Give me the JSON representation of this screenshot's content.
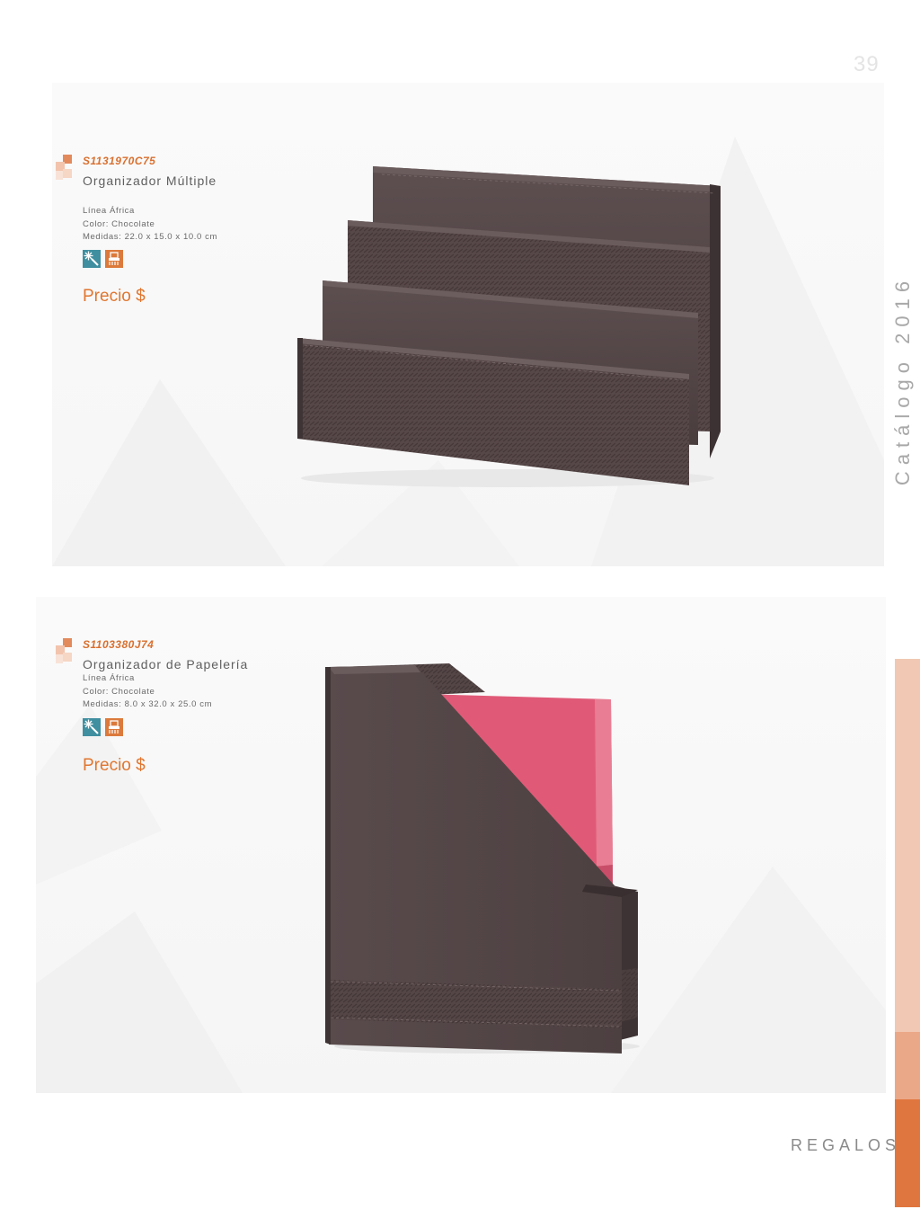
{
  "page": {
    "number": "39",
    "side_title": "Catálogo 2016",
    "section": "REGALOS"
  },
  "colors": {
    "accent": "#e0762f",
    "bar_light": "#f1c8b3",
    "bar_mid": "#eba888",
    "bar_dark": "#e0763f",
    "product_brown": "#57494a",
    "folder_pink": "#e05a77",
    "icon_teal": "#3f8fa0",
    "icon_orange": "#dc7a3c"
  },
  "products": [
    {
      "sku": "S1131970C75",
      "name": "Organizador Múltiple",
      "line": "Línea África",
      "color": "Color: Chocolate",
      "measures": "Medidas: 22.0 x 15.0 x 10.0 cm",
      "icons": [
        "laser-engraving-icon",
        "hot-stamping-icon"
      ],
      "price": "Precio $"
    },
    {
      "sku": "S1103380J74",
      "name": "Organizador de Papelería",
      "line": "Línea África",
      "color": "Color: Chocolate",
      "measures": "Medidas: 8.0 x 32.0 x 25.0 cm",
      "icons": [
        "laser-engraving-icon",
        "hot-stamping-icon"
      ],
      "price": "Precio $"
    }
  ]
}
